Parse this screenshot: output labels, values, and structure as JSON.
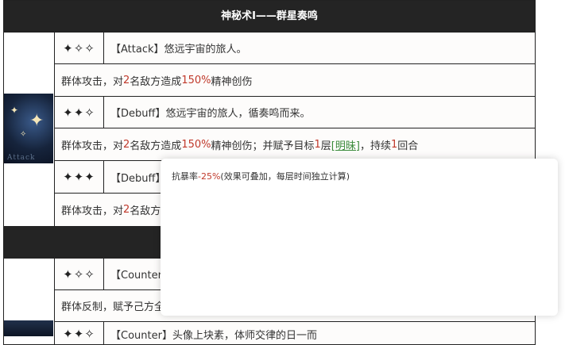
{
  "header": {
    "title": "神秘术Ⅰ——群星奏鸣"
  },
  "rows": [
    {
      "stars": "✦✧✧",
      "tag": "【Attack】悠远宇宙的旅人。",
      "effect": {
        "pre": "群体攻击，对",
        "num": "2",
        "mid": "名敌方造成",
        "pct": "150%",
        "post": "精神创伤"
      }
    },
    {
      "stars": "✦✦✧",
      "tag": "【Debuff】悠远宇宙的旅人，循奏鸣而来。",
      "effect": {
        "pre": "群体攻击，对",
        "num": "2",
        "mid": "名敌方造成",
        "pct": "150%",
        "post": "精神创伤；并赋予目标",
        "layers": "1",
        "layer_unit": "层",
        "status": "[明昧]",
        "dur_pre": "，持续",
        "dur": "1",
        "dur_post": "回合"
      }
    },
    {
      "stars": "✦✦✦",
      "tag": "【Debuff】",
      "effect": {
        "pre": "群体攻击，对",
        "num": "2",
        "mid": "名敌方"
      }
    }
  ],
  "section2": {
    "rows": [
      {
        "stars": "✦✧✧",
        "tag": "【Counter",
        "effect": {
          "pre": "群体反制，赋予己方全"
        }
      },
      {
        "stars": "✦✦✧",
        "tag": "【Counter】头像上块素，体师交律的日一而"
      }
    ]
  },
  "skill_icon": {
    "label": "Attack"
  },
  "tooltip": {
    "pre": "抗暴率",
    "value": "-25%",
    "post": "(效果可叠加，每层时间独立计算)"
  }
}
